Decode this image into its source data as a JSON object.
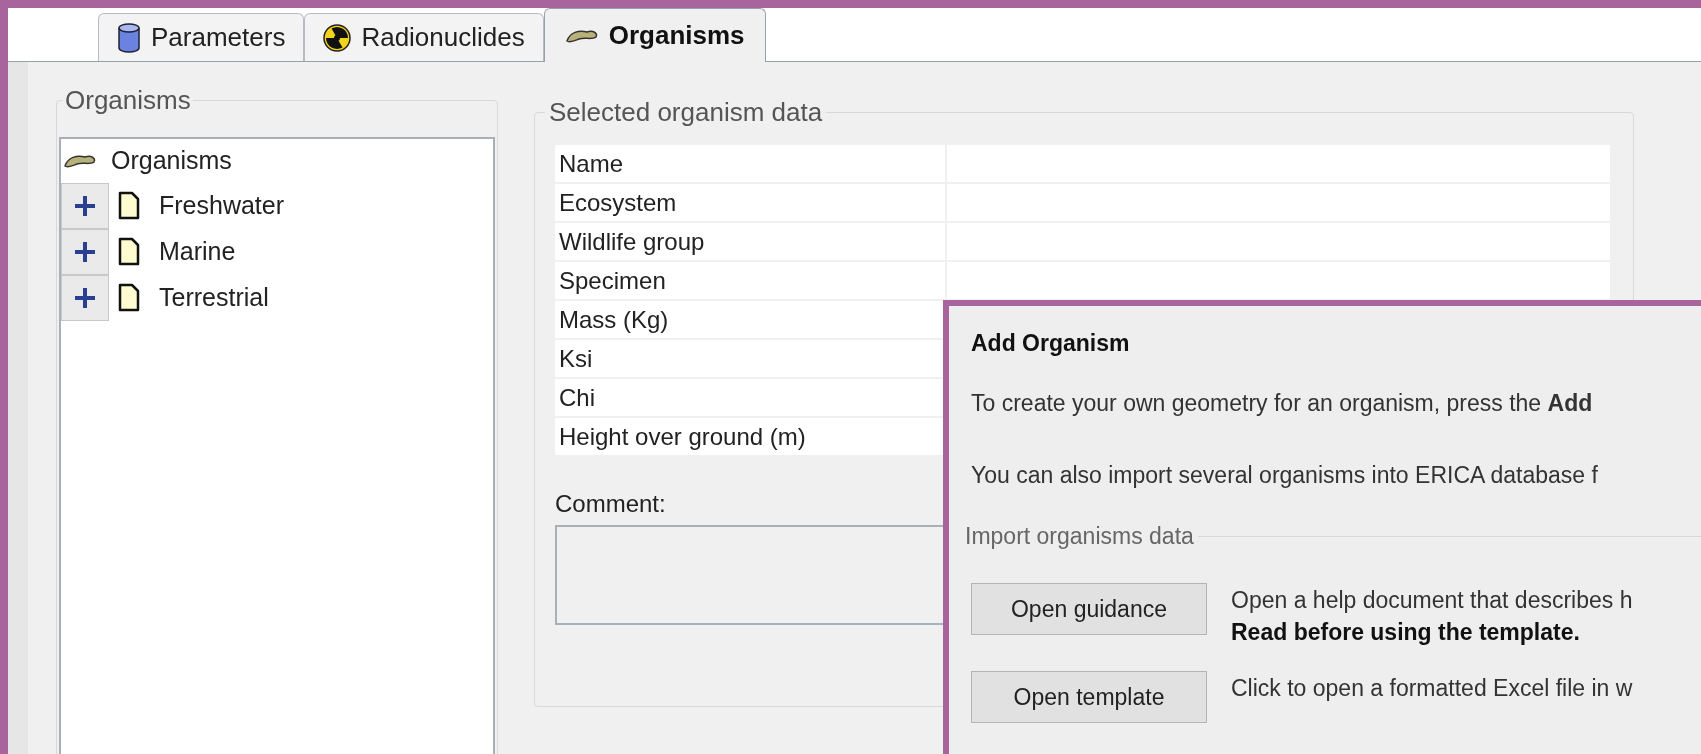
{
  "tabs": [
    {
      "label": "Parameters",
      "selected": false
    },
    {
      "label": "Radionuclides",
      "selected": false
    },
    {
      "label": "Organisms",
      "selected": true
    }
  ],
  "tree": {
    "title": "Organisms",
    "root": "Organisms",
    "children": [
      {
        "label": "Freshwater",
        "expanded": false
      },
      {
        "label": "Marine",
        "expanded": false
      },
      {
        "label": "Terrestrial",
        "expanded": false
      }
    ]
  },
  "organism_data": {
    "title": "Selected organism data",
    "fields": [
      "Name",
      "Ecosystem",
      "Wildlife group",
      "Specimen",
      "Mass (Kg)",
      "Ksi",
      "Chi",
      "Height over ground (m)"
    ],
    "comment_label": "Comment:"
  },
  "dialog": {
    "title": "Add Organism",
    "paragraphs": [
      "To create your own geometry for an organism, press the **Add**",
      "You can also import several organisms into ERICA database f"
    ],
    "import_group": {
      "title": "Import organisms data",
      "actions": [
        {
          "button": "Open guidance",
          "description": "Open a help document that describes h",
          "note": "Read before using the template."
        },
        {
          "button": "Open template",
          "description": "Click to open a formatted Excel file in w"
        }
      ]
    }
  }
}
